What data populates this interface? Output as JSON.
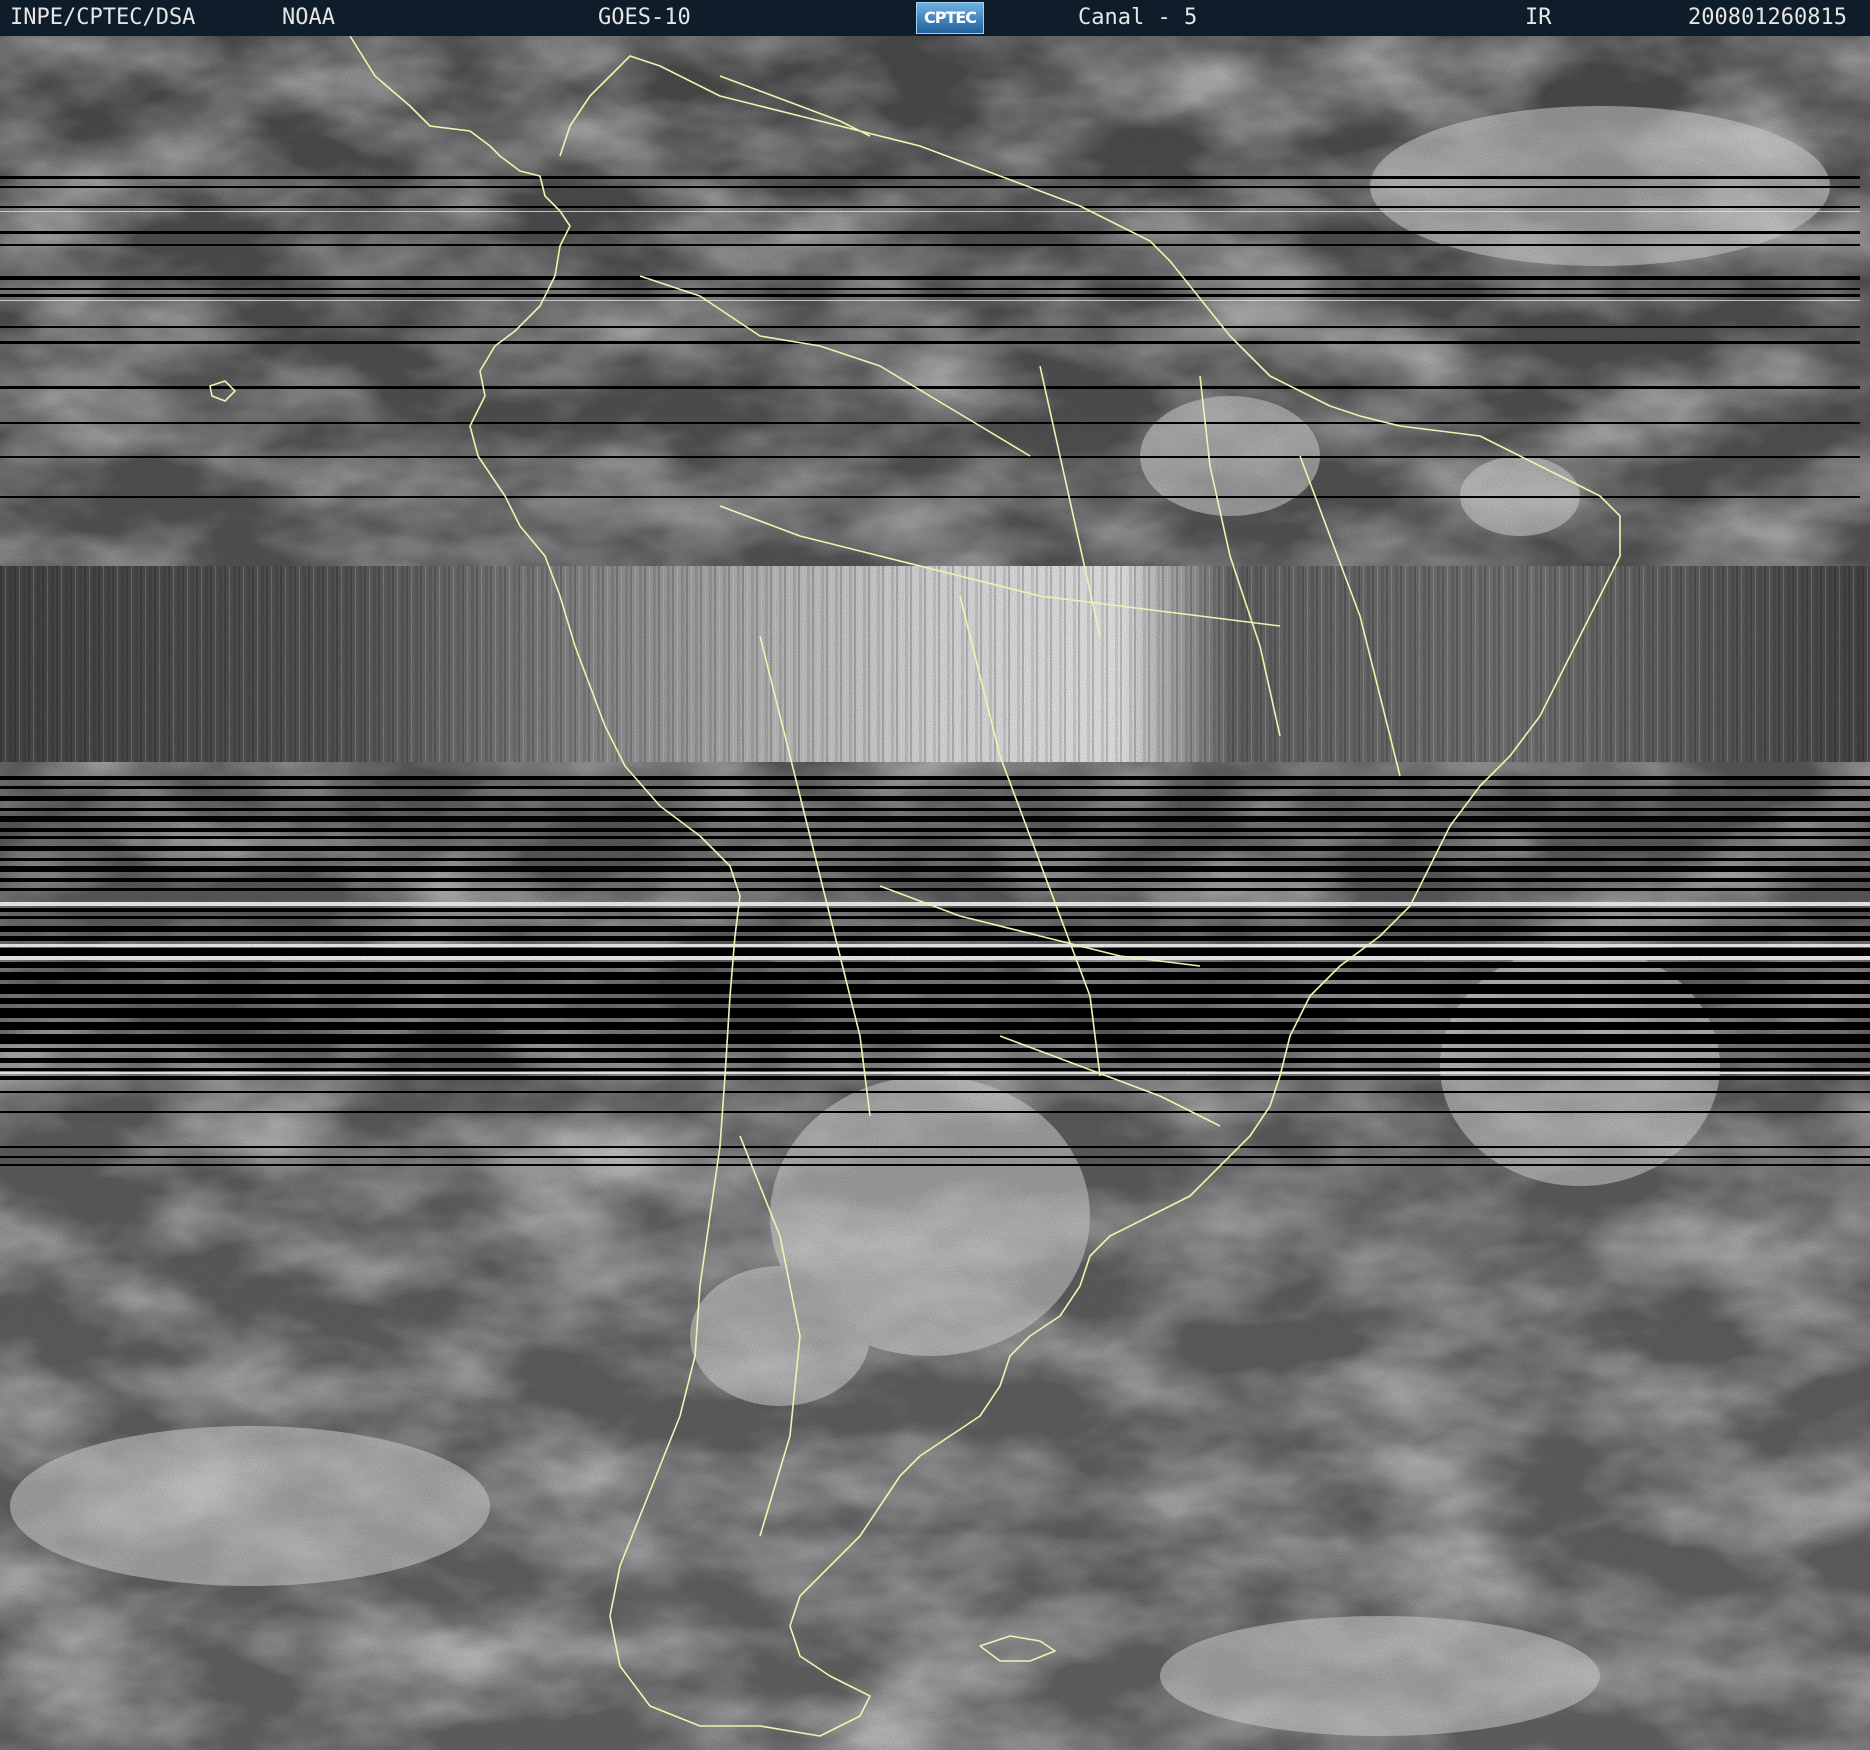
{
  "header": {
    "source": "INPE/CPTEC/DSA",
    "agency": "NOAA",
    "satellite": "GOES-10",
    "logo_text": "CPTEC",
    "channel": "Canal - 5",
    "band": "IR",
    "timestamp": "200801260815"
  },
  "colors": {
    "header_background": "#0f1c2a",
    "header_text": "#e6e6e6",
    "coastline": "#f2f2b0",
    "ocean_gray": "#5a5a5a",
    "cloud_white": "#e8e8e8"
  },
  "imagery": {
    "type": "satellite-ir-grayscale",
    "region": "South America",
    "overlay": "political borders and coastlines",
    "artifacts": "horizontal scan-line dropouts and vertical striping band"
  }
}
